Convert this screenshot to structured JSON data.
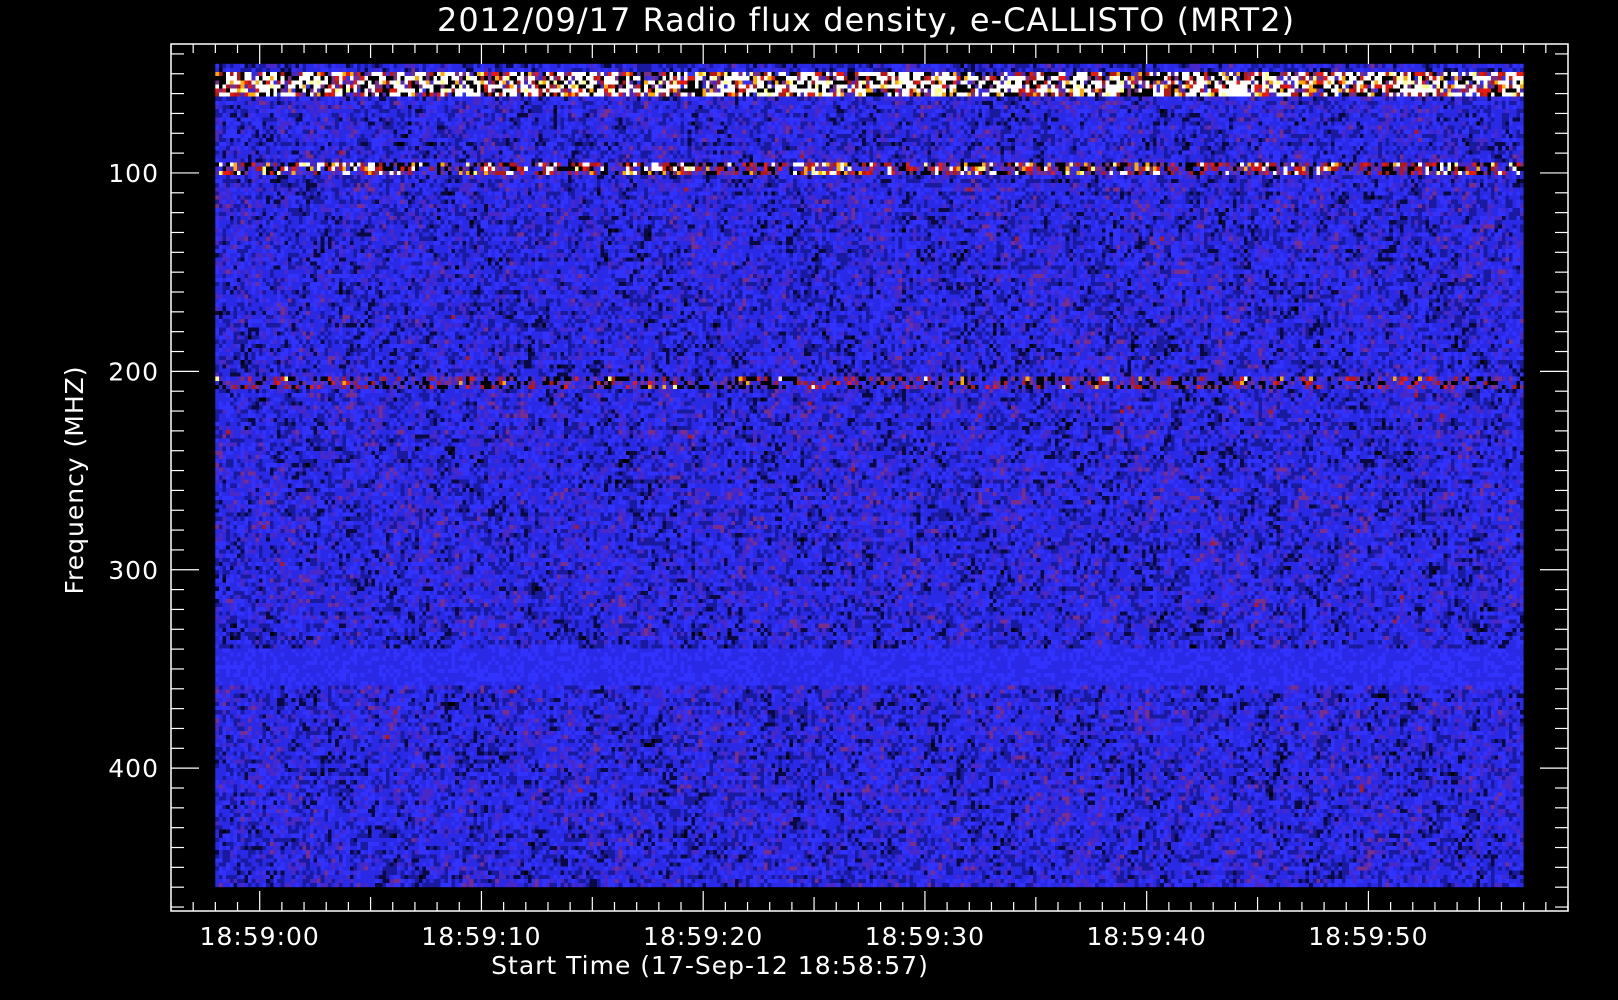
{
  "chart_data": {
    "type": "heatmap",
    "title": "2012/09/17  Radio flux density, e-CALLISTO (MRT2)",
    "xlabel": "Start Time (17-Sep-12 18:58:57)",
    "ylabel": "Frequency (MHZ)",
    "x_axis": {
      "unit": "seconds since 18:58:57",
      "range": [
        -1,
        62
      ],
      "data_range": [
        1,
        60
      ],
      "major_ticks": [
        3,
        13,
        23,
        33,
        43,
        53
      ],
      "tick_labels": [
        "18:59:00",
        "18:59:10",
        "18:59:20",
        "18:59:30",
        "18:59:40",
        "18:59:50"
      ],
      "minor_step": 1
    },
    "y_axis": {
      "unit": "MHz",
      "inverted": true,
      "range": [
        35,
        472
      ],
      "data_range": [
        45,
        460
      ],
      "major_ticks": [
        100,
        200,
        300,
        400
      ],
      "tick_labels": [
        "100",
        "200",
        "300",
        "400"
      ],
      "minor_step": 10
    },
    "colormap": [
      "#000000",
      "#0a0a40",
      "#1a1a9e",
      "#2a2ae6",
      "#3232ff",
      "#4a28c8",
      "#7a2e8c",
      "#b41818",
      "#e81a10",
      "#ffaa00",
      "#ffff80",
      "#ffffff"
    ],
    "features": [
      {
        "frequency_mhz": 52,
        "intensity": "high"
      },
      {
        "frequency_mhz": 57,
        "intensity": "high"
      },
      {
        "frequency_mhz": 97,
        "intensity": "medium-high"
      },
      {
        "frequency_mhz": 205,
        "intensity": "medium"
      },
      {
        "frequency_mhz": 350,
        "intensity": "low-uniform"
      }
    ],
    "grid": false,
    "legend": "none"
  },
  "colors": {
    "background": "#000000",
    "axes": "#ffffff",
    "text": "#ffffff"
  }
}
